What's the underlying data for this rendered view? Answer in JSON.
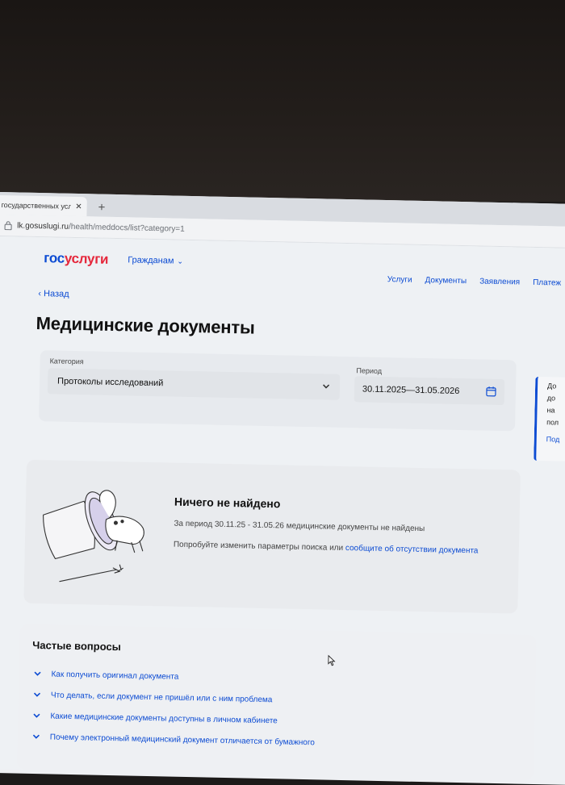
{
  "browser": {
    "tab_title": "государственных услуг",
    "url_host": "lk.gosuslugi.ru",
    "url_path": "/health/meddocs/list?category=1"
  },
  "header": {
    "logo_gos": "гос",
    "logo_uslugi": "услуги",
    "citizens": "Гражданам",
    "nav": [
      "Услуги",
      "Документы",
      "Заявления",
      "Платеж"
    ]
  },
  "page": {
    "back": "Назад",
    "title": "Медицинские документы"
  },
  "filters": {
    "category_label": "Категория",
    "category_value": "Протоколы исследований",
    "period_label": "Период",
    "period_value": "30.11.2025—31.05.2026"
  },
  "side_card": {
    "lines": [
      "До",
      "до",
      "на",
      "пол"
    ],
    "link": "Под"
  },
  "empty": {
    "title": "Ничего не найдено",
    "description": "За период 30.11.25 - 31.05.26 медицинские документы не найдены",
    "hint_prefix": "Попробуйте изменить параметры поиска или ",
    "hint_link": "сообщите об отсутствии документа"
  },
  "faq": {
    "title": "Частые вопросы",
    "items": [
      "Как получить оригинал документа",
      "Что делать, если документ не пришёл или с ним проблема",
      "Какие медицинские документы доступны в личном кабинете",
      "Почему электронный медицинский документ отличается от бумажного"
    ]
  },
  "icons": {
    "close": "close-icon",
    "new_tab": "plus-icon",
    "lock": "lock-icon",
    "chevron": "chevron-down-icon",
    "calendar": "calendar-icon",
    "cursor": "cursor-icon"
  },
  "colors": {
    "brand_blue": "#0d4cd3",
    "brand_red": "#e5283c"
  }
}
